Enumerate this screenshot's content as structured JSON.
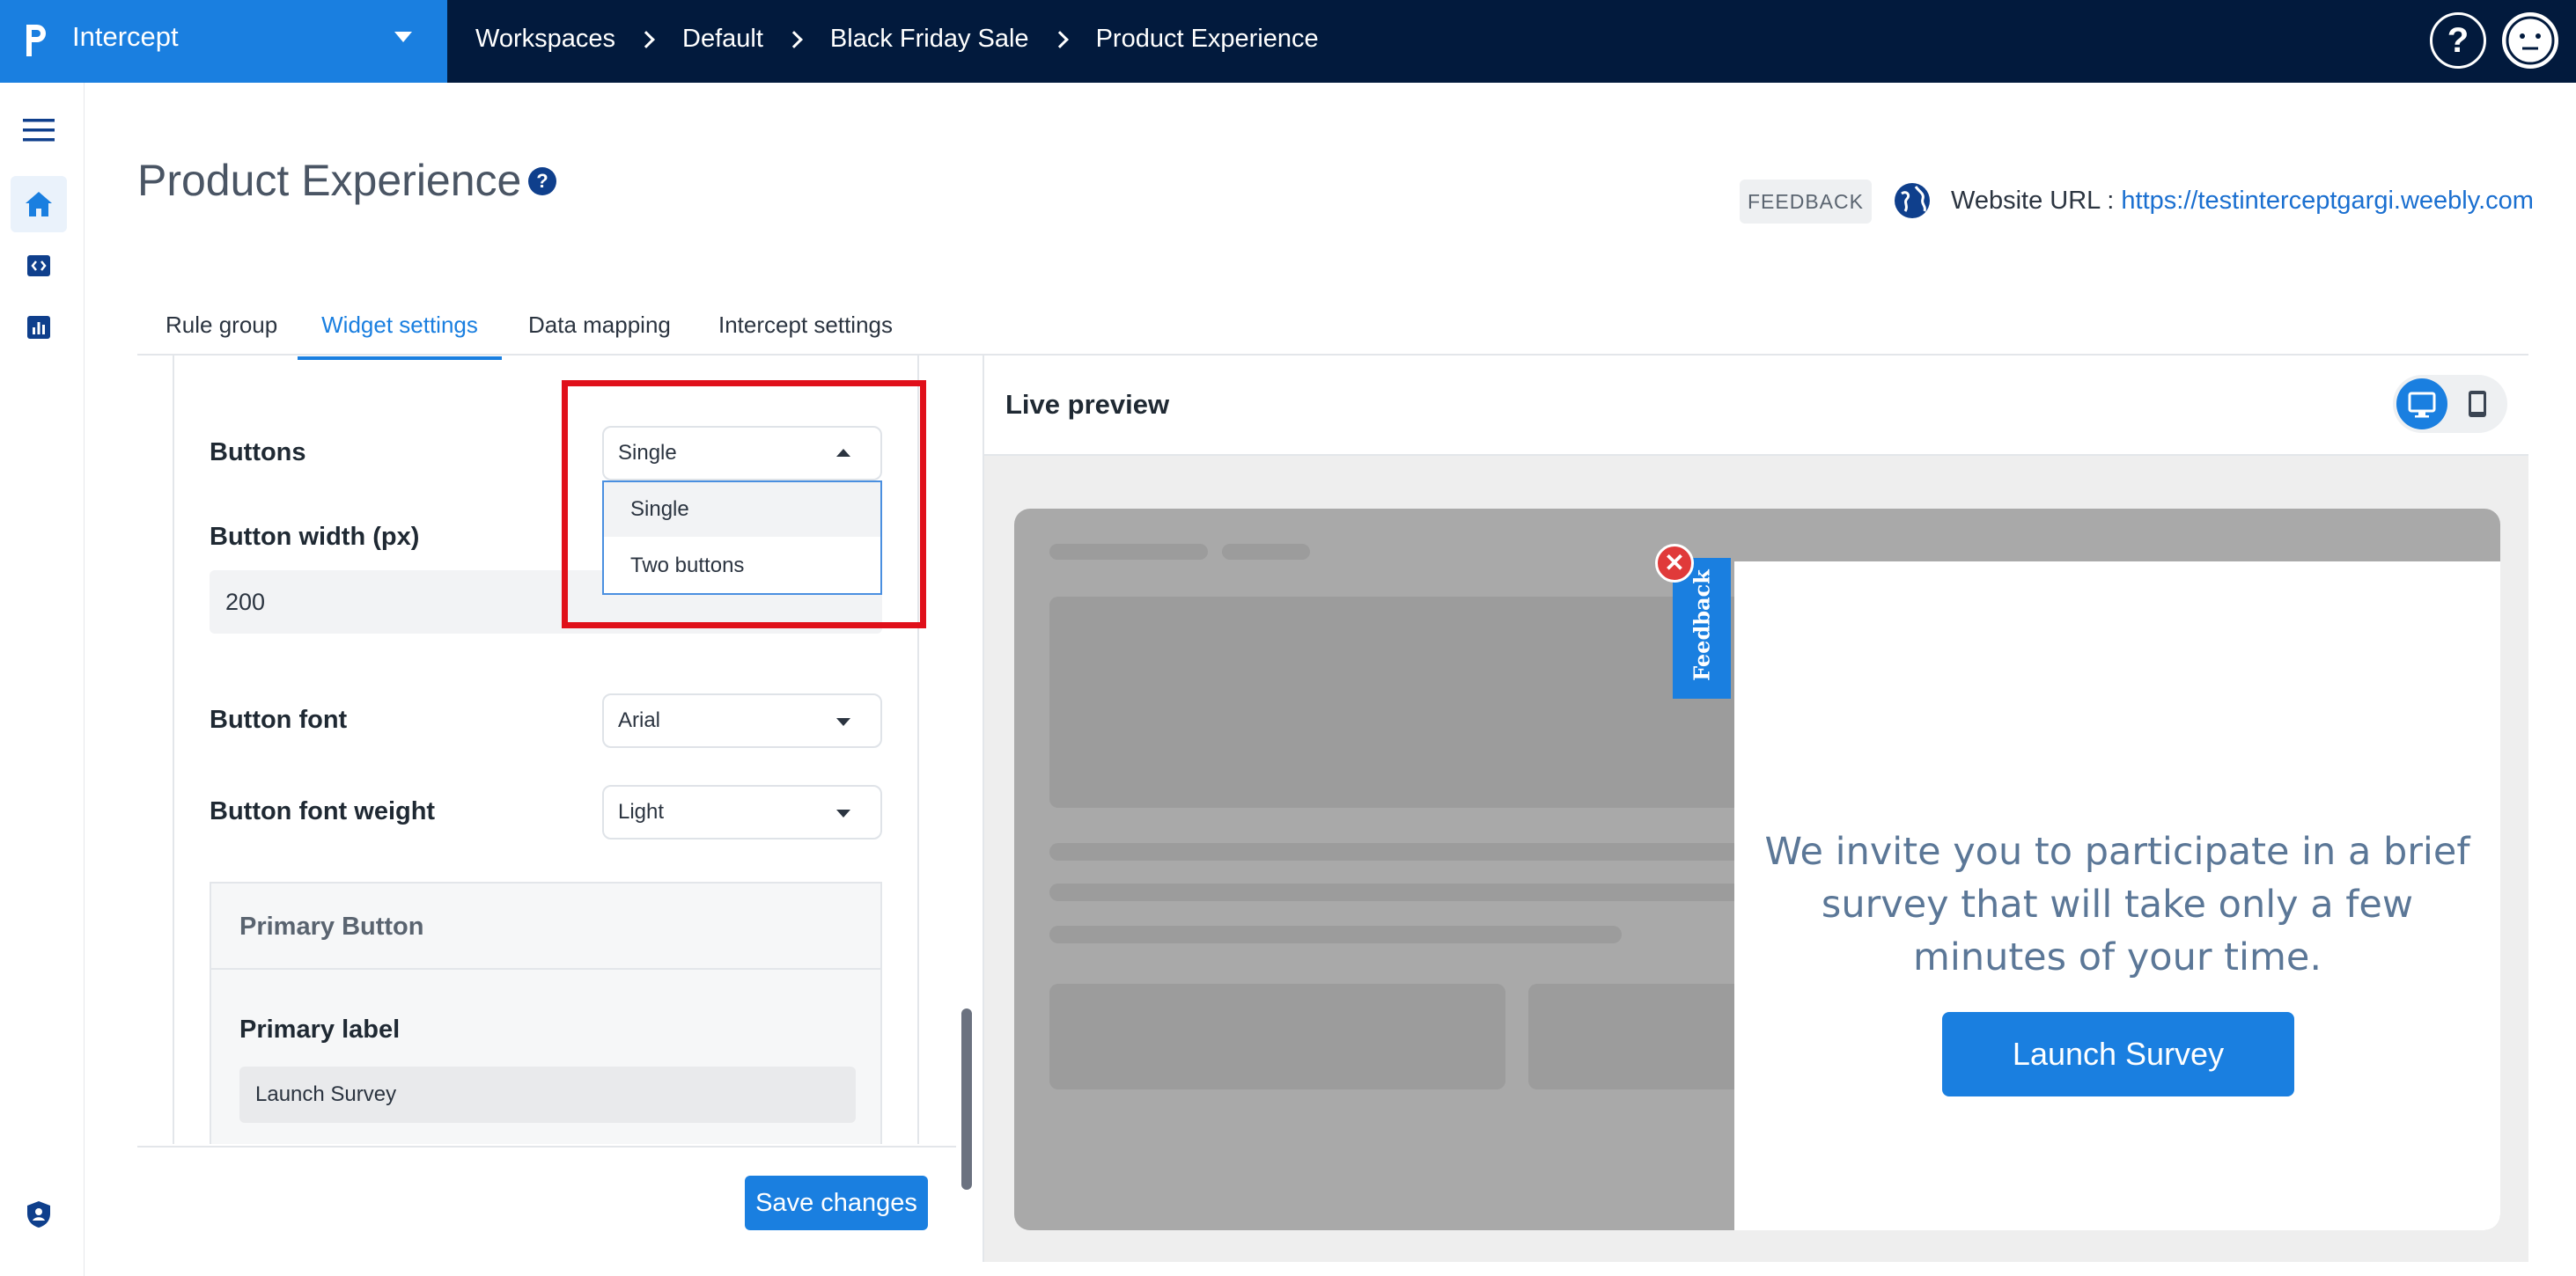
{
  "app": {
    "name": "Intercept"
  },
  "breadcrumb": [
    "Workspaces",
    "Default",
    "Black Friday Sale",
    "Product Experience"
  ],
  "page": {
    "title": "Product Experience",
    "feedback_chip": "FEEDBACK",
    "website_url_label": "Website URL : ",
    "website_url": "https://testinterceptgargi.weebly.com"
  },
  "tabs": [
    {
      "label": "Rule group",
      "active": false
    },
    {
      "label": "Widget settings",
      "active": true
    },
    {
      "label": "Data mapping",
      "active": false
    },
    {
      "label": "Intercept settings",
      "active": false
    }
  ],
  "settings": {
    "buttons_label": "Buttons",
    "buttons_value": "Single",
    "buttons_options": [
      "Single",
      "Two buttons"
    ],
    "button_width_label": "Button width (px)",
    "button_width_value": "200",
    "button_font_label": "Button font",
    "button_font_value": "Arial",
    "button_font_weight_label": "Button font weight",
    "button_font_weight_value": "Light",
    "primary_section_title": "Primary Button",
    "primary_label_label": "Primary label",
    "primary_label_value": "Launch Survey",
    "save_label": "Save changes"
  },
  "preview": {
    "title": "Live preview",
    "feedback_tab": "Feedback",
    "close_glyph": "✕",
    "message": "We invite you to participate in a brief survey that will take only a few minutes of your time.",
    "button_label": "Launch Survey"
  },
  "colors": {
    "accent": "#1a7fe0",
    "topbar": "#021a3d",
    "highlight": "#e0101a"
  }
}
